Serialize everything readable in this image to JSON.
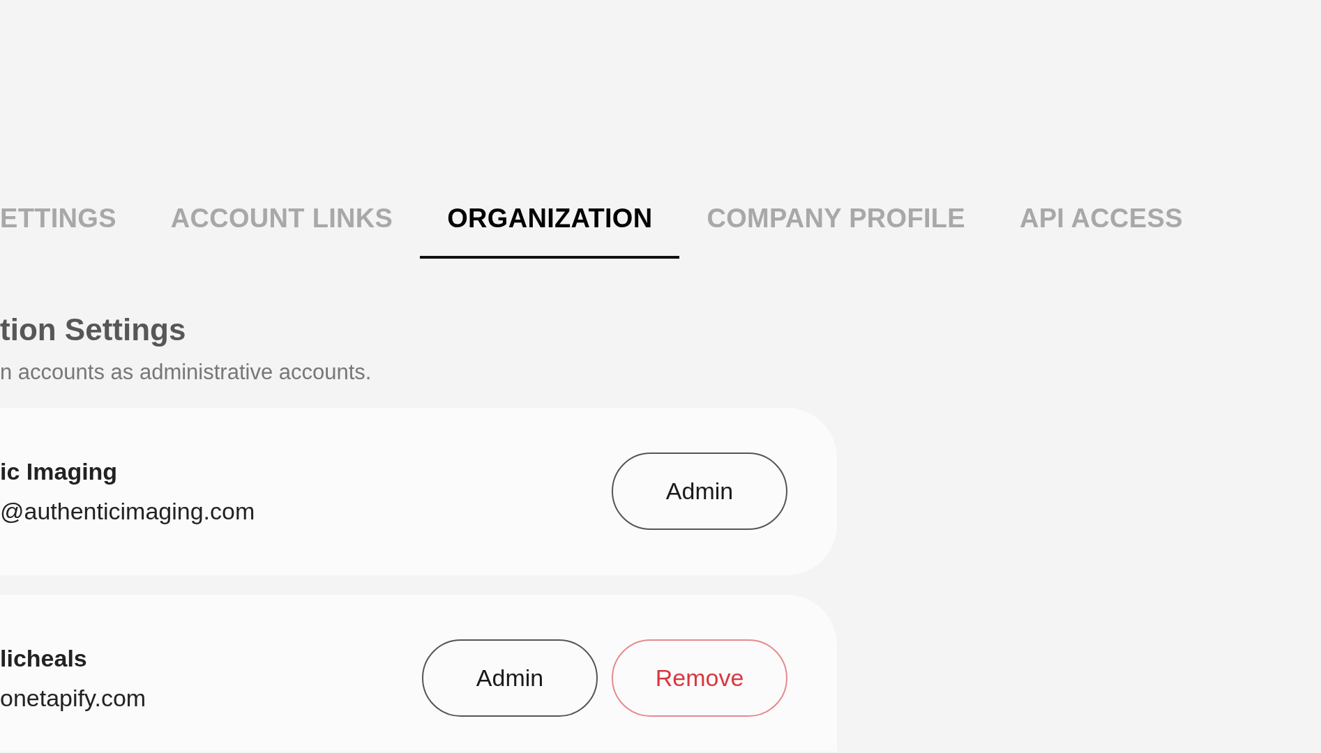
{
  "tabs": [
    {
      "label": "ETTINGS",
      "selected": false
    },
    {
      "label": "ACCOUNT LINKS",
      "selected": false
    },
    {
      "label": "ORGANIZATION",
      "selected": true
    },
    {
      "label": "COMPANY PROFILE",
      "selected": false
    },
    {
      "label": "API ACCESS",
      "selected": false
    }
  ],
  "section": {
    "title": "tion Settings",
    "description": "n accounts as administrative accounts."
  },
  "accounts": [
    {
      "name": "ic Imaging",
      "email": "@authenticimaging.com",
      "actions": [
        {
          "label": "Admin",
          "kind": "admin"
        }
      ]
    },
    {
      "name": "licheals",
      "email": "onetapify.com",
      "actions": [
        {
          "label": "Admin",
          "kind": "admin"
        },
        {
          "label": "Remove",
          "kind": "remove"
        }
      ]
    }
  ]
}
